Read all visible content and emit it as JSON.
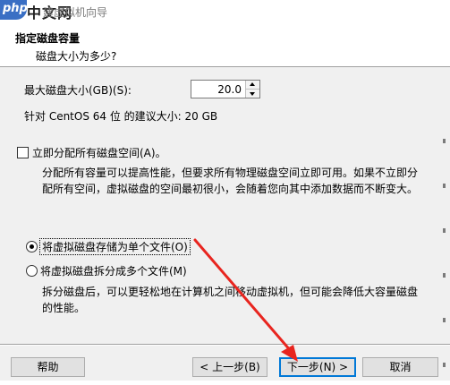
{
  "titlebar": {
    "logo_text": "php",
    "watermark": "中文网",
    "window_title": "建虚拟机向导"
  },
  "header": {
    "title": "指定磁盘容量",
    "subtitle": "磁盘大小为多少?"
  },
  "disk_size": {
    "label": "最大磁盘大小(GB)(S):",
    "value": "20.0",
    "recommendation": "针对 CentOS 64 位 的建议大小: 20 GB"
  },
  "allocate_now": {
    "label": "立即分配所有磁盘空间(A)。",
    "checked": false,
    "description": "分配所有容量可以提高性能，但要求所有物理磁盘空间立即可用。如果不立即分配所有空间，虚拟磁盘的空间最初很小，会随着您向其中添加数据而不断变大。"
  },
  "storage_mode": {
    "selected": "single",
    "single_label": "将虚拟磁盘存储为单个文件(O)",
    "multi_label": "将虚拟磁盘拆分成多个文件(M)",
    "multi_description": "拆分磁盘后，可以更轻松地在计算机之间移动虚拟机，但可能会降低大容量磁盘的性能。"
  },
  "footer": {
    "help": "帮助",
    "back": "< 上一步(B)",
    "next": "下一步(N) >",
    "cancel": "取消"
  },
  "annotation": {
    "arrow_color": "#e8251f"
  }
}
